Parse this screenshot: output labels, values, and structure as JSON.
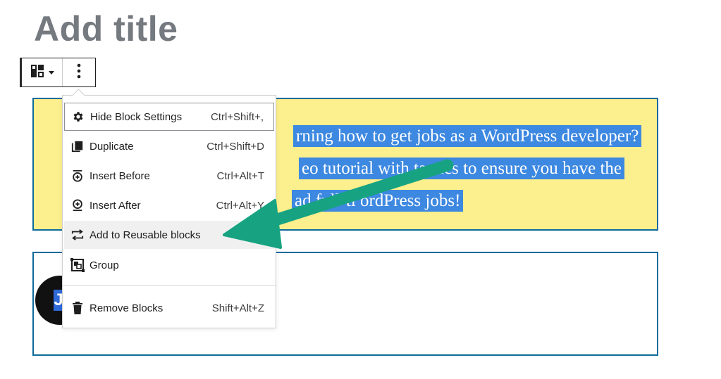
{
  "editor": {
    "title_placeholder": "Add title"
  },
  "toolbar": {
    "block_switcher_icon": "block-layout-icon",
    "more_icon": "vertical-ellipsis-icon"
  },
  "paragraph": {
    "lines": [
      "rning how to get jobs as a WordPress developer?",
      "eo tutorial with tactics to ensure you have the",
      "ad full-ti     ordPress jobs!"
    ]
  },
  "avatar": {
    "letter": "J"
  },
  "menu": {
    "items": [
      {
        "label": "Hide Block Settings",
        "shortcut": "Ctrl+Shift+,",
        "icon": "gear-icon"
      },
      {
        "label": "Duplicate",
        "shortcut": "Ctrl+Shift+D",
        "icon": "duplicate-icon"
      },
      {
        "label": "Insert Before",
        "shortcut": "Ctrl+Alt+T",
        "icon": "insert-before-icon"
      },
      {
        "label": "Insert After",
        "shortcut": "Ctrl+Alt+Y",
        "icon": "insert-after-icon"
      },
      {
        "label": "Add to Reusable blocks",
        "shortcut": "",
        "icon": "reusable-block-icon"
      },
      {
        "label": "Group",
        "shortcut": "",
        "icon": "group-icon"
      },
      {
        "label": "Remove Blocks",
        "shortcut": "Shift+Alt+Z",
        "icon": "trash-icon"
      }
    ]
  },
  "colors": {
    "highlight_block_bg": "#fcef8d",
    "block_border": "#0e6a9c",
    "selection": "#3d88e0",
    "arrow": "#17a382"
  }
}
